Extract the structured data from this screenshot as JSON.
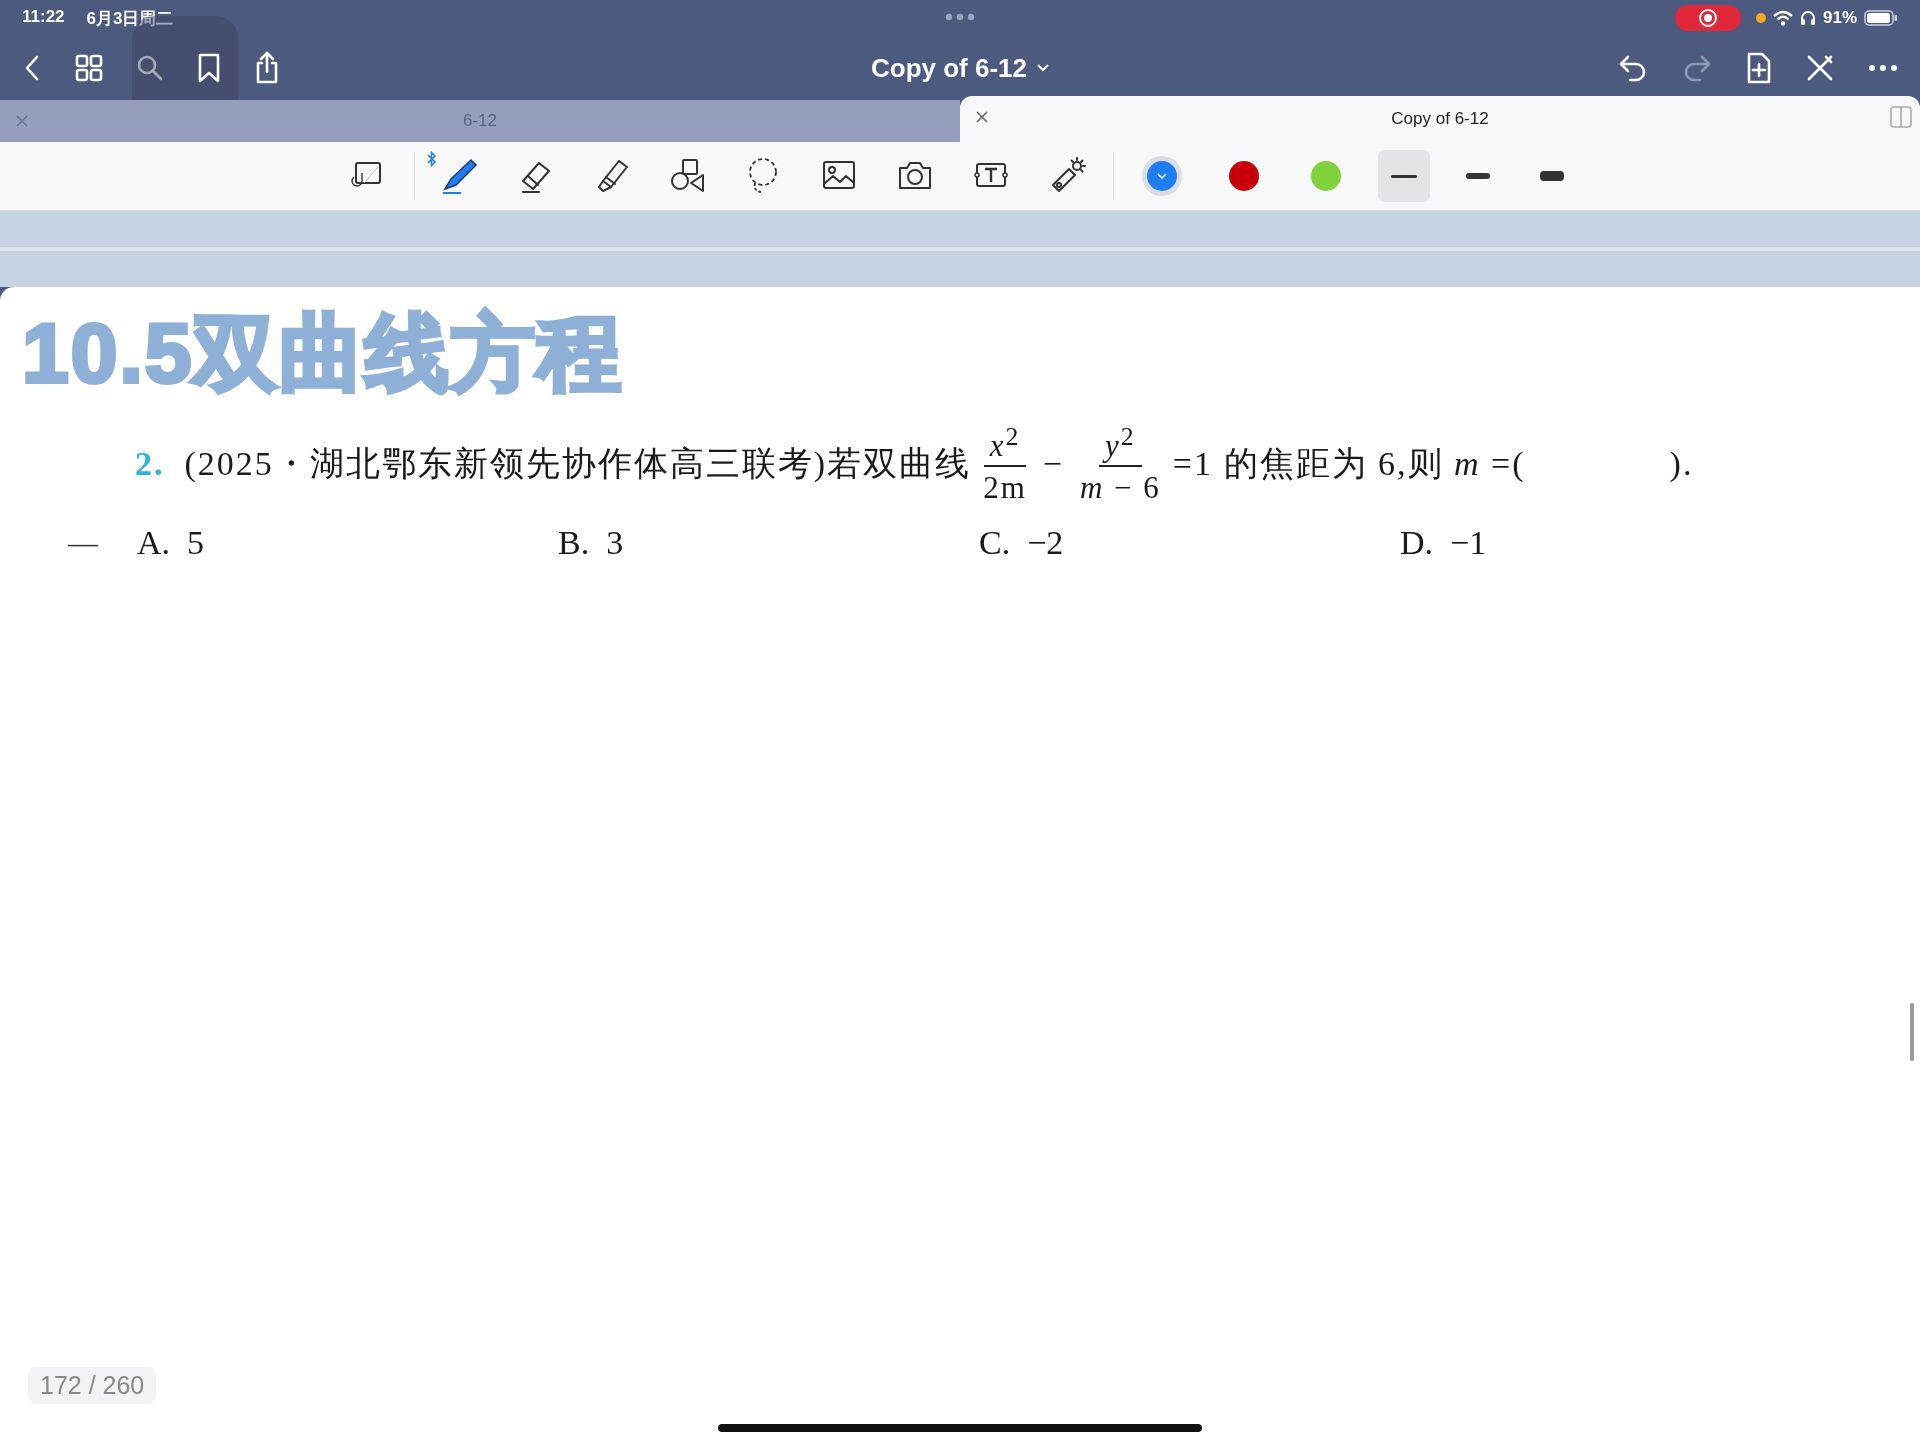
{
  "status_bar": {
    "time": "11:22",
    "date": "6月3日周二",
    "battery": "91%",
    "recording": true
  },
  "nav": {
    "title": "Copy of 6-12"
  },
  "tabs": [
    {
      "label": "6-12",
      "selected": false
    },
    {
      "label": "Copy of 6-12",
      "selected": true
    }
  ],
  "tools": [
    {
      "kind": "convert",
      "selected": false
    },
    {
      "kind": "pen",
      "selected": true
    },
    {
      "kind": "eraser",
      "selected": false
    },
    {
      "kind": "highlighter",
      "selected": false
    },
    {
      "kind": "shapes",
      "selected": false
    },
    {
      "kind": "lasso",
      "selected": false
    },
    {
      "kind": "image",
      "selected": false
    },
    {
      "kind": "camera",
      "selected": false
    },
    {
      "kind": "textbox",
      "selected": false
    },
    {
      "kind": "laser",
      "selected": false
    }
  ],
  "colors": [
    {
      "color": "#1e7ef0",
      "selected": true
    },
    {
      "color": "#c8000a",
      "selected": false
    },
    {
      "color": "#7ed33c",
      "selected": false
    }
  ],
  "widths": [
    {
      "selected": true
    },
    {
      "selected": false
    },
    {
      "selected": false
    }
  ],
  "page": {
    "heading": "10.5双曲线方程",
    "question": {
      "number": "2.",
      "source": "(2025・湖北鄂东新领先协作体高三联考)若双曲线",
      "fraction_1": {
        "numerator": "*x*$^{2}$",
        "denominator": "2m"
      },
      "operator": "−",
      "fraction_2": {
        "numerator": "*y*$^{2}$",
        "denominator": "*m* − 6"
      },
      "tail": "=1 的焦距为 6,则 *m* =(　　　　)."
    },
    "mark": "—",
    "options": [
      "A.  5",
      "B.  3",
      "C.  −2",
      "D.  −1"
    ]
  },
  "page_counter": "172 / 260"
}
